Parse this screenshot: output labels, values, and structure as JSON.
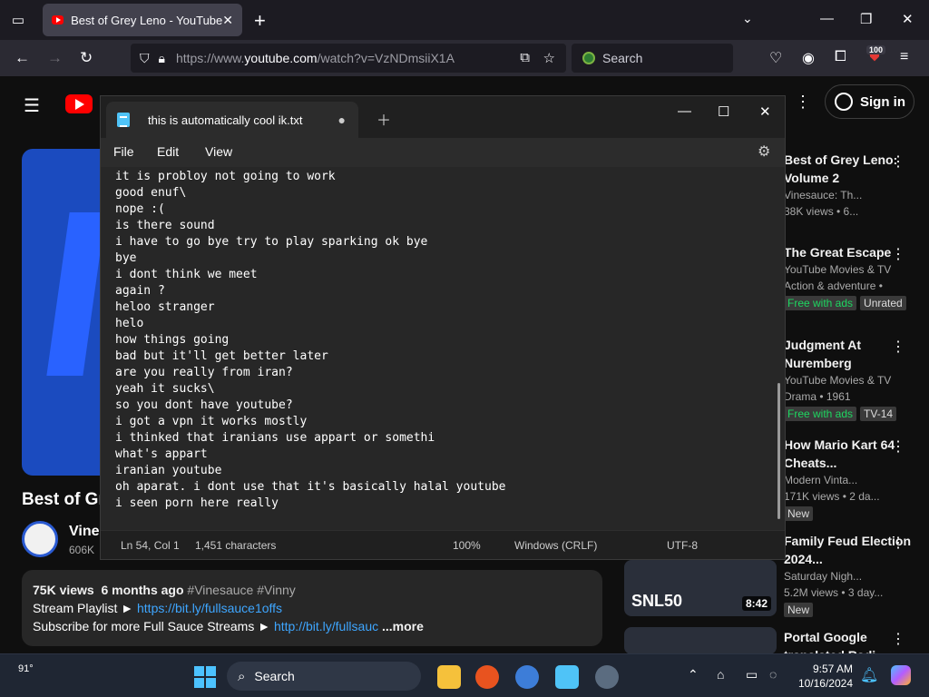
{
  "browser": {
    "tab_title": "Best of Grey Leno - YouTube",
    "url_prefix": "https://www.",
    "url_host": "youtube.com",
    "url_path": "/watch?v=VzNDmsiiX1A",
    "search_placeholder": "Search",
    "badge_count": "100"
  },
  "youtube": {
    "sign_in": "Sign in",
    "video_title": "Best of Gr",
    "channel_name": "Vine",
    "channel_subs": "606K",
    "description": {
      "views": "75K views",
      "age": "6 months ago",
      "tags": "#Vinesauce #Vinny",
      "line2_label": "Stream Playlist ►",
      "line2_link": "https://bit.ly/fullsauce1offs",
      "line3_label": "Subscribe for more Full Sauce Streams ►",
      "line3_link": "http://bit.ly/fullsauc",
      "more": "...more"
    },
    "recommendations": [
      {
        "title": "Best of Grey Leno: Volume 2",
        "channel": "Vinesauce: Th...",
        "meta": "38K views • 6..."
      },
      {
        "title": "The Great Escape",
        "channel": "YouTube Movies & TV",
        "meta": "Action & adventure •",
        "chip1": "Free with ads",
        "chip2": "Unrated"
      },
      {
        "title": "Judgment At Nuremberg",
        "channel": "YouTube Movies & TV",
        "meta": "Drama • 1961",
        "chip1": "Free with ads",
        "chip2": "TV-14"
      },
      {
        "title": "How Mario Kart 64 Cheats...",
        "channel": "Modern Vinta...",
        "meta": "171K views • 2 da...",
        "chip1": "New"
      },
      {
        "title": "Family Feud Election 2024...",
        "channel": "Saturday Nigh...",
        "meta": "5.2M views • 3 day...",
        "chip1": "New",
        "thumb_text": "SNL50",
        "duration": "8:42"
      },
      {
        "title": "Portal Google translated Radi",
        "channel": "",
        "meta": ""
      }
    ]
  },
  "notepad": {
    "tab_title": "this is automatically cool ik.txt",
    "menu": [
      "File",
      "Edit",
      "View"
    ],
    "lines": [
      "it is probloy not going to work",
      "good enuf\\",
      "nope :(",
      "is there sound",
      "i have to go bye try to play sparking ok bye",
      "bye",
      "i dont think we meet",
      "again ?",
      "heloo stranger",
      "helo",
      "how things going",
      "bad but it'll get better later",
      "are you really from iran?",
      "yeah it sucks\\",
      "so you dont have youtube?",
      "i got a vpn it works mostly",
      "i thinked that iranians use appart or somethi",
      "what's appart",
      "iranian youtube",
      "oh aparat. i dont use that it's basically halal youtube",
      "i seen porn here really"
    ],
    "status": {
      "position": "Ln 54, Col 1",
      "chars": "1,451 characters",
      "zoom": "100%",
      "line_ending": "Windows (CRLF)",
      "encoding": "UTF-8"
    }
  },
  "taskbar": {
    "temperature": "91°",
    "search": "Search",
    "time": "9:57 AM",
    "date": "10/16/2024"
  }
}
